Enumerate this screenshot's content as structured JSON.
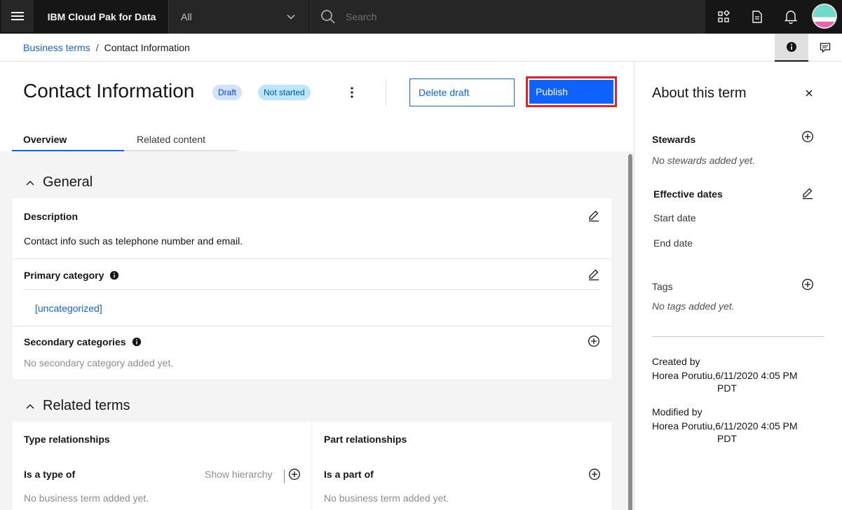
{
  "header": {
    "brand": "IBM Cloud Pak for Data",
    "scope_value": "All",
    "search_placeholder": "Search"
  },
  "breadcrumb": {
    "parent": "Business terms",
    "separator": "/",
    "current": "Contact Information"
  },
  "page": {
    "title": "Contact Information",
    "tags": [
      "Draft",
      "Not started"
    ],
    "delete_button": "Delete draft",
    "publish_button": "Publish"
  },
  "tabs": [
    "Overview",
    "Related content"
  ],
  "general": {
    "heading": "General",
    "description_label": "Description",
    "description_text": "Contact info such as telephone number and email.",
    "primary_category_label": "Primary category",
    "primary_category_value": "[uncategorized]",
    "secondary_categories_label": "Secondary categories",
    "secondary_categories_empty": "No secondary category added yet."
  },
  "related_terms": {
    "heading": "Related terms",
    "type_relationships": "Type relationships",
    "part_relationships": "Part relationships",
    "is_a_type_of": "Is a type of",
    "show_hierarchy": "Show hierarchy",
    "is_a_part_of": "Is a part of",
    "empty_left": "No business term added yet.",
    "empty_right": "No business term added yet."
  },
  "side_panel": {
    "title": "About this term",
    "stewards_label": "Stewards",
    "stewards_empty": "No stewards added yet.",
    "effective_dates_label": "Effective dates",
    "start_date": "Start date",
    "end_date": "End date",
    "tags_label": "Tags",
    "tags_empty": "No tags added yet.",
    "created_by_label": "Created by",
    "created_by_value": "Horea Porutiu,6/11/2020 4:05 PM",
    "created_by_tz": "PDT",
    "modified_by_label": "Modified by",
    "modified_by_value": "Horea Porutiu,6/11/2020 4:05 PM",
    "modified_by_tz": "PDT"
  },
  "colors": {
    "accent": "#0f62fe",
    "header_bg": "#161616",
    "highlight_border": "#e8202a"
  }
}
